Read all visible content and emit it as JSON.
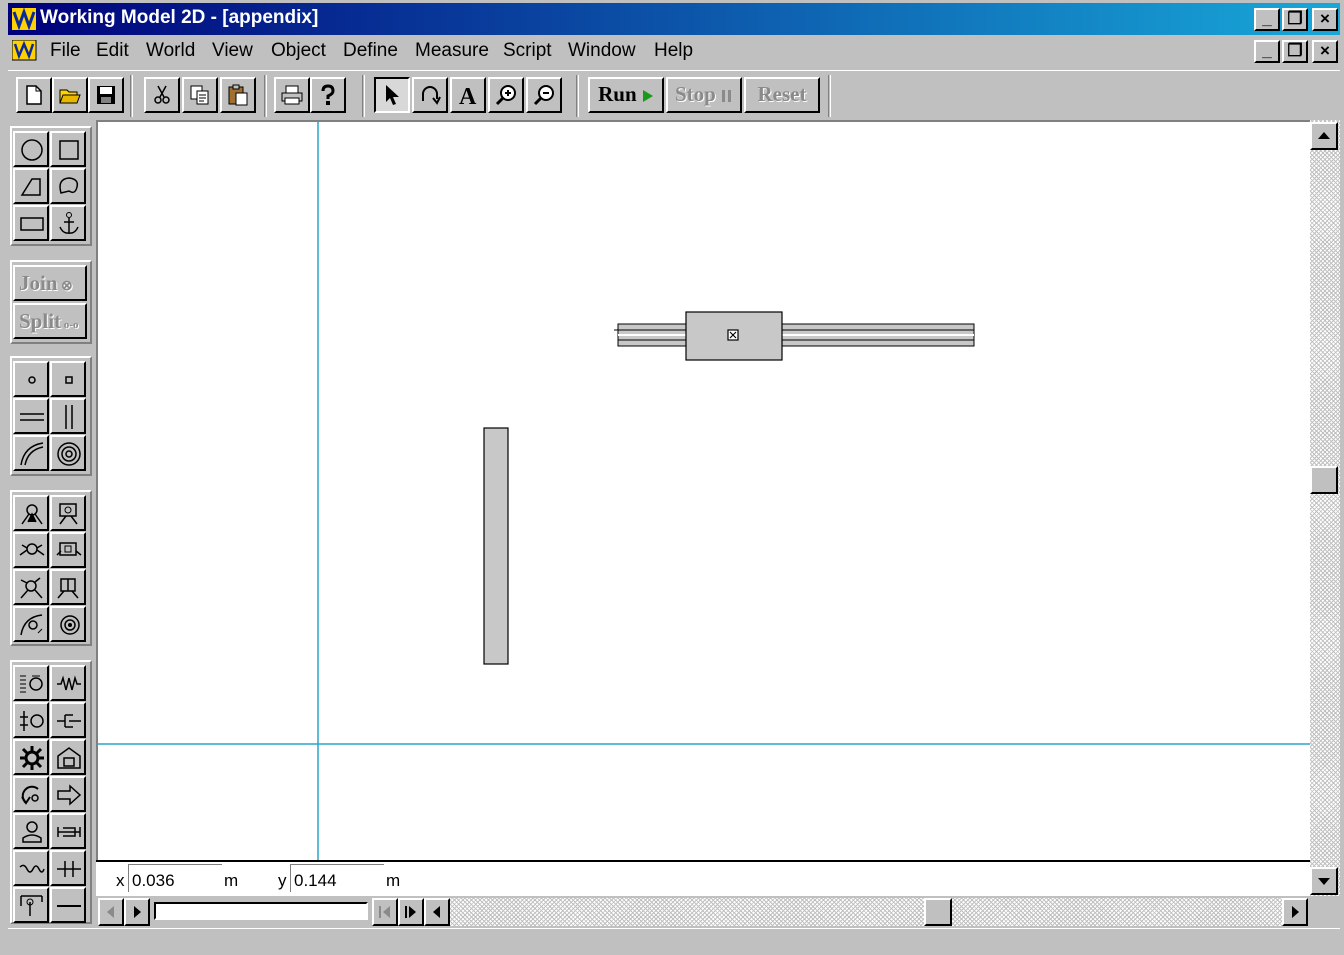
{
  "window": {
    "title": "Working Model 2D - [appendix]"
  },
  "window_controls": {
    "minimize": "_",
    "restore": "❐",
    "close": "×"
  },
  "menu": {
    "items": [
      {
        "label": "File"
      },
      {
        "label": "Edit"
      },
      {
        "label": "World"
      },
      {
        "label": "View"
      },
      {
        "label": "Object"
      },
      {
        "label": "Define"
      },
      {
        "label": "Measure"
      },
      {
        "label": "Script"
      },
      {
        "label": "Window"
      },
      {
        "label": "Help"
      }
    ]
  },
  "toolbar": {
    "icons": [
      "new-file-icon",
      "open-folder-icon",
      "save-icon",
      "cut-icon",
      "copy-icon",
      "paste-icon",
      "print-icon",
      "help-icon",
      "arrow-pointer-icon",
      "rotate-icon",
      "text-tool-icon",
      "zoom-in-icon",
      "zoom-out-icon"
    ],
    "run_label": "Run",
    "stop_label": "Stop",
    "reset_label": "Reset",
    "run_icon_color": "#1a9a1a"
  },
  "palette": {
    "join_label": "Join",
    "split_label": "Split"
  },
  "coords": {
    "x_label": "x",
    "x_value": "0.036",
    "x_unit": "m",
    "y_label": "y",
    "y_value": "0.144",
    "y_unit": "m"
  },
  "colors": {
    "title_gradient_start": "#00007a",
    "title_gradient_end": "#18a8d8",
    "axis_line": "#2aa6c8",
    "body_fill": "#c8c8c8"
  }
}
